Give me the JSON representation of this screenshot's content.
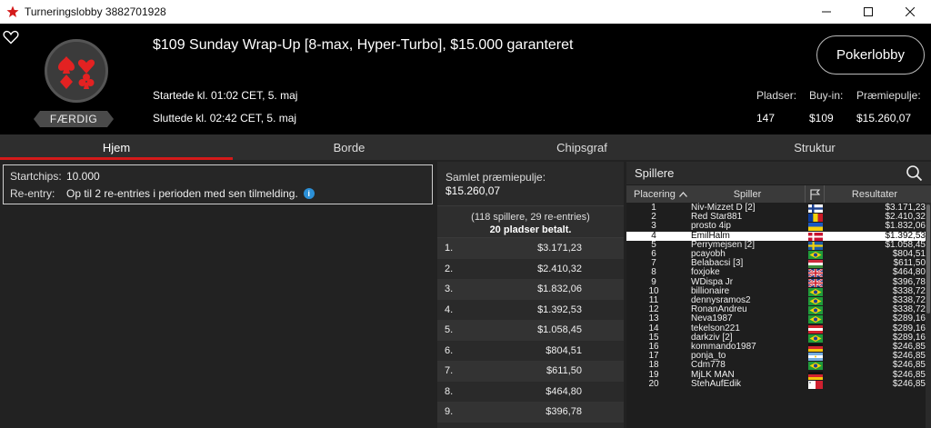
{
  "window": {
    "title": "Turneringslobby 3882701928"
  },
  "header": {
    "tournament_name": "$109 Sunday Wrap-Up [8-max, Hyper-Turbo], $15.000 garanteret",
    "started": "Startede kl. 01:02 CET, 5. maj",
    "ended": "Sluttede kl. 02:42 CET, 5. maj",
    "status_badge": "FÆRDIG",
    "lobby_button": "Pokerlobby",
    "stats": {
      "seats_label": "Pladser:",
      "seats_value": "147",
      "buyin_label": "Buy-in:",
      "buyin_value": "$109",
      "prizepool_label": "Præmiepulje:",
      "prizepool_value": "$15.260,07"
    }
  },
  "tabs": [
    {
      "label": "Hjem",
      "active": true
    },
    {
      "label": "Borde",
      "active": false
    },
    {
      "label": "Chipsgraf",
      "active": false
    },
    {
      "label": "Struktur",
      "active": false
    }
  ],
  "info": {
    "startchips_label": "Startchips:",
    "startchips_value": "10.000",
    "reentry_label": "Re-entry:",
    "reentry_value": "Op til 2 re-entries i perioden med sen tilmelding."
  },
  "prize": {
    "title": "Samlet præmiepulje:",
    "total": "$15.260,07",
    "players_line": "(118 spillere, 29 re-entries)",
    "paid_line": "20 pladser betalt.",
    "rows": [
      {
        "place": "1.",
        "amount": "$3.171,23"
      },
      {
        "place": "2.",
        "amount": "$2.410,32"
      },
      {
        "place": "3.",
        "amount": "$1.832,06"
      },
      {
        "place": "4.",
        "amount": "$1.392,53"
      },
      {
        "place": "5.",
        "amount": "$1.058,45"
      },
      {
        "place": "6.",
        "amount": "$804,51"
      },
      {
        "place": "7.",
        "amount": "$611,50"
      },
      {
        "place": "8.",
        "amount": "$464,80"
      },
      {
        "place": "9.",
        "amount": "$396,78"
      }
    ]
  },
  "players": {
    "title": "Spillere",
    "col_place": "Placering",
    "col_player": "Spiller",
    "col_results": "Resultater",
    "highlight_index": 3,
    "rows": [
      {
        "place": "1",
        "name": "Niv-Mizzet D [2]",
        "flag": "finland",
        "result": "$3.171,23"
      },
      {
        "place": "2",
        "name": "Red Star881",
        "flag": "romania",
        "result": "$2.410,32"
      },
      {
        "place": "3",
        "name": "prosto 4ip",
        "flag": "ukraine",
        "result": "$1.832,06"
      },
      {
        "place": "4",
        "name": "EmilHalm",
        "flag": "denmark",
        "result": "$1.392,53"
      },
      {
        "place": "5",
        "name": "Perrymejsen [2]",
        "flag": "sweden",
        "result": "$1.058,45"
      },
      {
        "place": "6",
        "name": "pcayobh",
        "flag": "brazil",
        "result": "$804,51"
      },
      {
        "place": "7",
        "name": "Belabacsi [3]",
        "flag": "hungary",
        "result": "$611,50"
      },
      {
        "place": "8",
        "name": "foxjoke",
        "flag": "uk",
        "result": "$464,80"
      },
      {
        "place": "9",
        "name": "WDispa Jr",
        "flag": "uk",
        "result": "$396,78"
      },
      {
        "place": "10",
        "name": "billionaire",
        "flag": "brazil",
        "result": "$338,72"
      },
      {
        "place": "11",
        "name": "dennysramos2",
        "flag": "brazil",
        "result": "$338,72"
      },
      {
        "place": "12",
        "name": "RonanAndreu",
        "flag": "brazil",
        "result": "$338,72"
      },
      {
        "place": "13",
        "name": "Neva1987",
        "flag": "brazil",
        "result": "$289,16"
      },
      {
        "place": "14",
        "name": "tekelson221",
        "flag": "austria",
        "result": "$289,16"
      },
      {
        "place": "15",
        "name": "darkziv [2]",
        "flag": "brazil",
        "result": "$289,16"
      },
      {
        "place": "16",
        "name": "kommando1987",
        "flag": "germany",
        "result": "$246,85"
      },
      {
        "place": "17",
        "name": "ponja_to",
        "flag": "argentina",
        "result": "$246,85"
      },
      {
        "place": "18",
        "name": "Cdm778",
        "flag": "brazil",
        "result": "$246,85"
      },
      {
        "place": "19",
        "name": "MjLK MAN",
        "flag": "germany",
        "result": "$246,85"
      },
      {
        "place": "20",
        "name": "StehAufEdik",
        "flag": "malta",
        "result": "$246,85"
      }
    ]
  },
  "colors": {
    "accent_red": "#d41a1a",
    "header_bg": "#000000",
    "panel_bg": "#222222",
    "info_icon": "#2b8fd6"
  }
}
